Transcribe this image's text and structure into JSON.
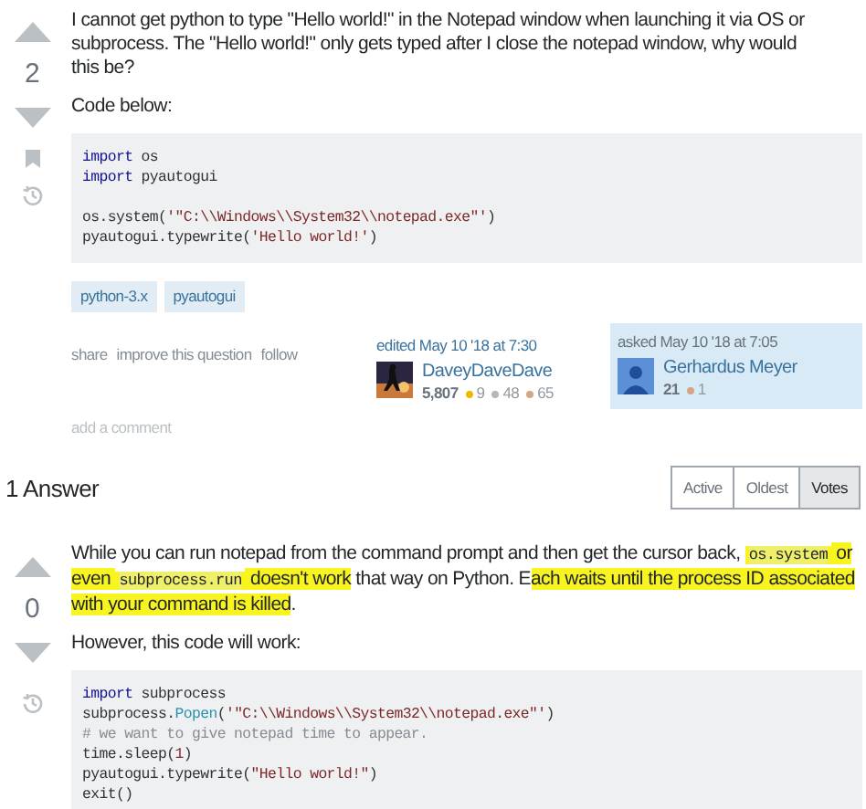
{
  "question": {
    "votes": "2",
    "paragraphs": [
      "I cannot get python to type \"Hello world!\" in the Notepad window when launching it via OS or subprocess. The \"Hello world!\" only gets typed after I close the notepad window, why would this be?",
      "Code below:"
    ],
    "code": [
      [
        [
          {
            "kind": "keyword",
            "text": "import"
          },
          {
            "kind": "plain",
            "text": " os"
          }
        ],
        [
          {
            "kind": "keyword",
            "text": "import"
          },
          {
            "kind": "plain",
            "text": " pyautogui"
          }
        ]
      ],
      [
        [
          {
            "kind": "plain",
            "text": "os.system("
          },
          {
            "kind": "string",
            "text": "'\"C:\\\\Windows\\\\System32\\\\notepad.exe\"'"
          },
          {
            "kind": "plain",
            "text": ")"
          }
        ],
        [
          {
            "kind": "plain",
            "text": "pyautogui.typewrite("
          },
          {
            "kind": "string",
            "text": "'Hello world!'"
          },
          {
            "kind": "plain",
            "text": ")"
          }
        ]
      ]
    ],
    "tags": [
      "python-3.x",
      "pyautogui"
    ],
    "actions": [
      "share",
      "improve this question",
      "follow"
    ],
    "edited": {
      "label": "edited May 10 '18 at 7:30",
      "user": "DaveyDaveDave",
      "reputation": "5,807",
      "badges": [
        {
          "count": "9",
          "color": "#f1b600"
        },
        {
          "count": "48",
          "color": "#b4b8bc"
        },
        {
          "count": "65",
          "color": "#d1a684"
        }
      ]
    },
    "asked": {
      "label": "asked May 10 '18 at 7:05",
      "user": "Gerhardus Meyer",
      "reputation": "21",
      "badges": [
        {
          "count": "1",
          "color": "#d1a684"
        }
      ]
    },
    "add_comment": "add a comment"
  },
  "answers_header": {
    "title": "1 Answer",
    "sort_tabs": [
      {
        "label": "Active",
        "selected": false
      },
      {
        "label": "Oldest",
        "selected": false
      },
      {
        "label": "Votes",
        "selected": true
      }
    ]
  },
  "answer": {
    "votes": "0",
    "paragraph": [
      {
        "text": "While you can run notepad from the command prompt and then get the cursor back, ",
        "highlighted": false,
        "kind": "text"
      },
      {
        "text": "os.system",
        "highlighted": true,
        "kind": "code"
      },
      {
        "text": " or even ",
        "highlighted": true,
        "kind": "text"
      },
      {
        "text": "subprocess.run",
        "highlighted": true,
        "kind": "code"
      },
      {
        "text": " doesn't work",
        "highlighted": true,
        "kind": "text"
      },
      {
        "text": " that way on Python. E",
        "highlighted": false,
        "kind": "text"
      },
      {
        "text": "ach waits until the process ID associated with your command is killed",
        "highlighted": true,
        "kind": "text"
      },
      {
        "text": ".",
        "highlighted": false,
        "kind": "text"
      }
    ],
    "paragraph_2": "However, this code will work:",
    "code": [
      [
        [
          {
            "kind": "keyword",
            "text": "import"
          },
          {
            "kind": "plain",
            "text": " subprocess"
          }
        ],
        [
          {
            "kind": "plain",
            "text": "subprocess."
          },
          {
            "kind": "func",
            "text": "Popen"
          },
          {
            "kind": "plain",
            "text": "("
          },
          {
            "kind": "string",
            "text": "'\"C:\\\\Windows\\\\System32\\\\notepad.exe\"'"
          },
          {
            "kind": "plain",
            "text": ")"
          }
        ],
        [
          {
            "kind": "comment",
            "text": "# we want to give notepad time to appear."
          }
        ],
        [
          {
            "kind": "plain",
            "text": "time.sleep("
          },
          {
            "kind": "string",
            "text": "1"
          },
          {
            "kind": "plain",
            "text": ")"
          }
        ],
        [
          {
            "kind": "plain",
            "text": "pyautogui.typewrite("
          },
          {
            "kind": "string",
            "text": "\"Hello world!\""
          },
          {
            "kind": "plain",
            "text": ")"
          }
        ],
        [
          {
            "kind": "plain",
            "text": "exit()"
          }
        ]
      ]
    ]
  }
}
